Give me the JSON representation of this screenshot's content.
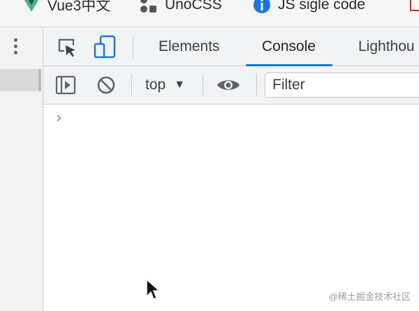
{
  "bookmarks": [
    {
      "label": "Vue3中文",
      "icon": "vue-logo-icon"
    },
    {
      "label": "UnoCSS",
      "icon": "unocss-logo-icon"
    },
    {
      "label": "JS sigle code",
      "icon": "info-icon"
    },
    {
      "label": "",
      "icon": "bookmark-icon"
    }
  ],
  "devtools": {
    "tabs": [
      "Elements",
      "Console",
      "Lighthou"
    ],
    "active_tab": "Console",
    "context": "top",
    "filter_placeholder": "Filter",
    "prompt_symbol": "›"
  },
  "watermark": "@稀土掘金技术社区",
  "colors": {
    "accent": "#1a73e8",
    "toolbar_bg": "#f1f3f4"
  }
}
